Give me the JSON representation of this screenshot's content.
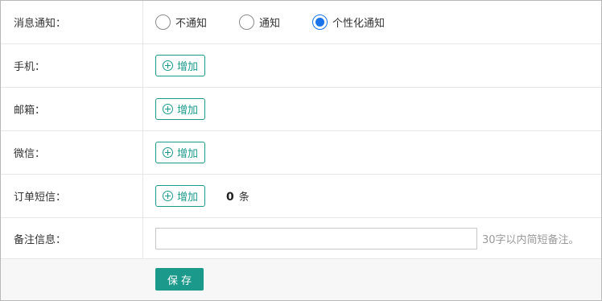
{
  "notification": {
    "label": "消息通知：",
    "options": [
      {
        "label": "不通知",
        "checked": false
      },
      {
        "label": "通知",
        "checked": false
      },
      {
        "label": "个性化通知",
        "checked": true
      }
    ]
  },
  "phone": {
    "label": "手机：",
    "add_label": "增加"
  },
  "email": {
    "label": "邮箱：",
    "add_label": "增加"
  },
  "wechat": {
    "label": "微信：",
    "add_label": "增加"
  },
  "order_sms": {
    "label": "订单短信：",
    "add_label": "增加",
    "count": "0",
    "count_unit": "条"
  },
  "remark": {
    "label": "备注信息：",
    "value": "",
    "hint": "30字以内简短备注。"
  },
  "save_label": "保存",
  "colors": {
    "accent": "#1b9a8c",
    "radio_selected": "#1a73e8",
    "border": "#e6e6e6"
  },
  "icons": {
    "add": "plus-circle-icon"
  }
}
